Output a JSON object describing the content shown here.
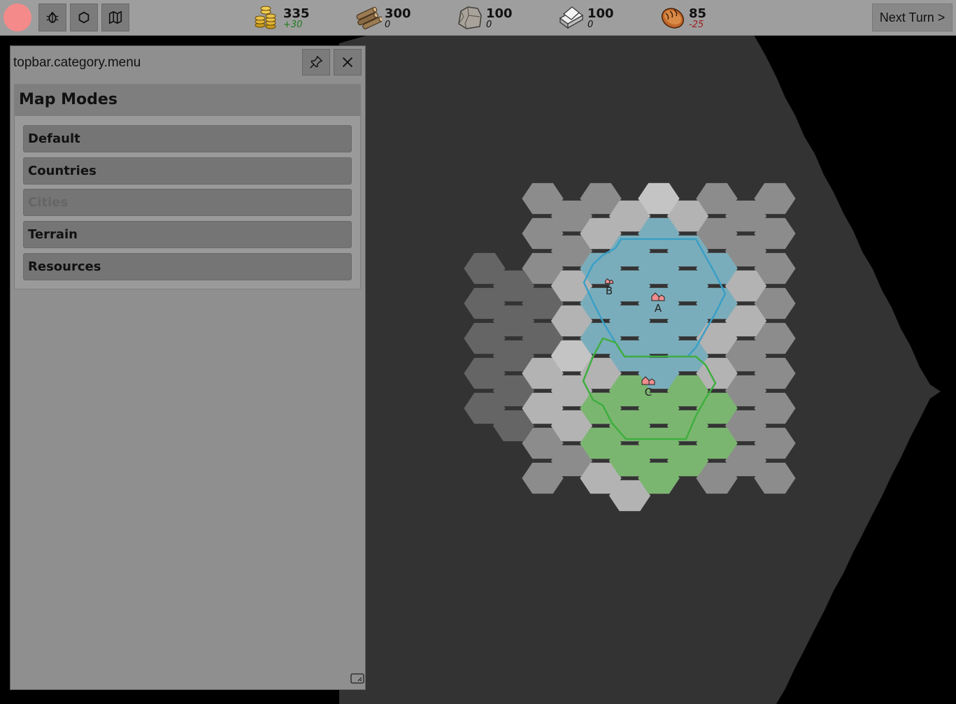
{
  "topbar": {
    "avatar": {
      "color": "#f48a8a"
    },
    "tool_buttons": [
      {
        "name": "bug-icon"
      },
      {
        "name": "hexagon-icon"
      },
      {
        "name": "map-icon"
      }
    ],
    "resources": [
      {
        "icon": "gold-coins-icon",
        "amount": "335",
        "delta": "+30",
        "delta_sign": "positive"
      },
      {
        "icon": "wood-logs-icon",
        "amount": "300",
        "delta": "0",
        "delta_sign": "zero"
      },
      {
        "icon": "stone-icon",
        "amount": "100",
        "delta": "0",
        "delta_sign": "zero"
      },
      {
        "icon": "iron-ingot-icon",
        "amount": "100",
        "delta": "0",
        "delta_sign": "zero"
      },
      {
        "icon": "bread-icon",
        "amount": "85",
        "delta": "-25",
        "delta_sign": "negative"
      }
    ],
    "next_turn_label": "Next Turn >"
  },
  "panel": {
    "title": "topbar.category.menu",
    "pin_icon": "pin-icon",
    "close_icon": "close-icon",
    "section_title": "Map Modes",
    "modes": [
      {
        "label": "Default",
        "enabled": true
      },
      {
        "label": "Countries",
        "enabled": true
      },
      {
        "label": "Cities",
        "enabled": false
      },
      {
        "label": "Terrain",
        "enabled": true
      },
      {
        "label": "Resources",
        "enabled": true
      }
    ],
    "resize_icon": "resize-handle-icon"
  },
  "map": {
    "cities": [
      {
        "label": "A",
        "country_color": "#7aadbb"
      },
      {
        "label": "B",
        "country_color": "#7aadbb"
      },
      {
        "label": "C",
        "country_color": "#7bb670"
      }
    ],
    "colors": {
      "background": "#333333",
      "country_blue": "#7aadbb",
      "country_blue_border": "#3a9fc6",
      "country_green": "#7bb670",
      "country_green_border": "#3fae3f",
      "city_marker": "#f08d8d"
    }
  }
}
